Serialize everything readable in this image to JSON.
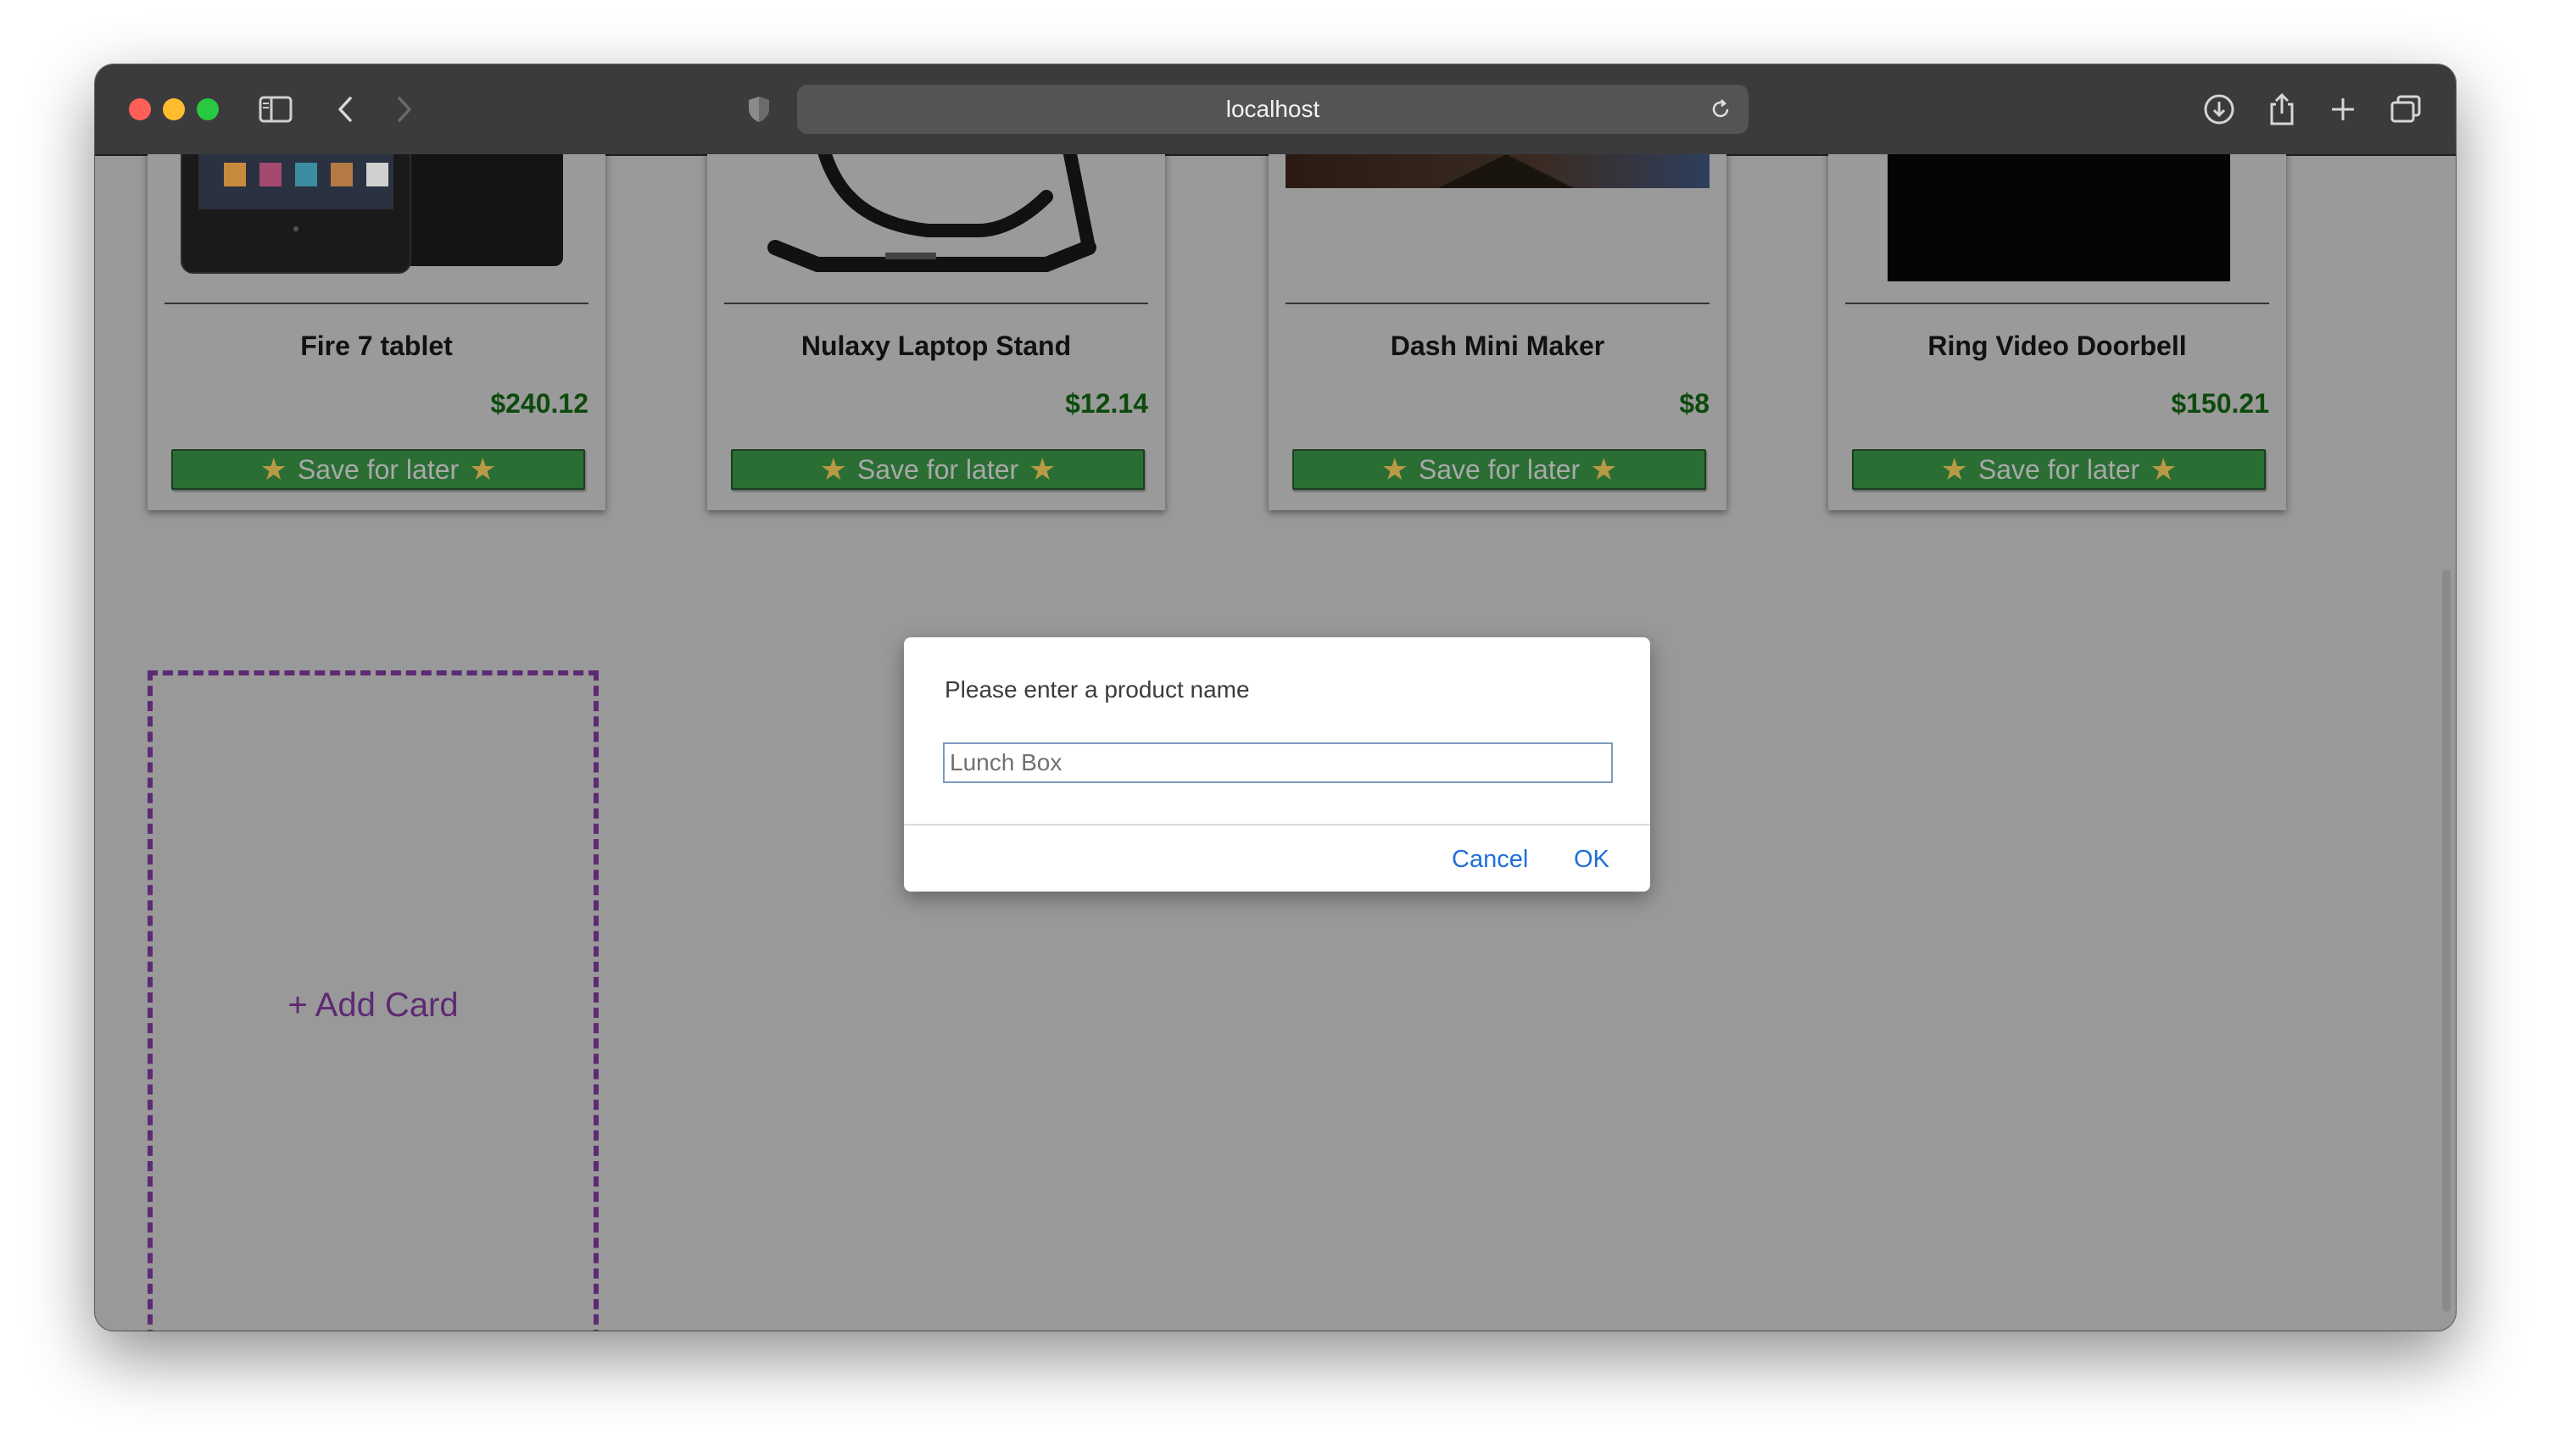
{
  "browser": {
    "url": "localhost"
  },
  "products": [
    {
      "name": "Fire 7 tablet",
      "price": "$240.12",
      "save_label": "Save for later"
    },
    {
      "name": "Nulaxy Laptop Stand",
      "price": "$12.14",
      "save_label": "Save for later"
    },
    {
      "name": "Dash Mini Maker",
      "price": "$8",
      "save_label": "Save for later"
    },
    {
      "name": "Ring Video Doorbell",
      "price": "$150.21",
      "save_label": "Save for later"
    }
  ],
  "add_card": {
    "label": "+ Add Card"
  },
  "prompt_dialog": {
    "message": "Please enter a product name",
    "input_value": "Lunch Box",
    "cancel_label": "Cancel",
    "ok_label": "OK"
  },
  "colors": {
    "save_button": "#2a6e33",
    "price_text": "#0d4a0d",
    "add_card_accent": "#5d2a74",
    "dialog_button": "#1f6fd6"
  }
}
